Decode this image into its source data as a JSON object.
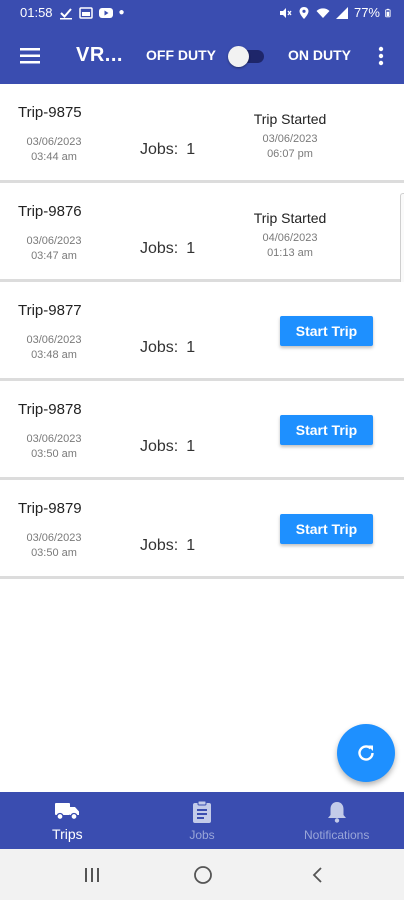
{
  "status_bar": {
    "time": "01:58",
    "battery": "77%",
    "left_icons": [
      "check-icon",
      "photo-icon",
      "youtube-icon",
      "dot-icon"
    ],
    "right_icons": [
      "mute-icon",
      "location-icon",
      "wifi-icon",
      "signal-icon",
      "battery-icon"
    ]
  },
  "app_bar": {
    "title": "VR...",
    "off_duty_label": "OFF DUTY",
    "on_duty_label": "ON DUTY",
    "duty_toggle_on": false
  },
  "jobs_label": "Jobs:",
  "start_trip_label": "Start Trip",
  "trips": [
    {
      "id": "Trip-9875",
      "date": "03/06/2023",
      "time": "03:44 am",
      "jobs": "1",
      "status": "Trip Started",
      "status_date": "03/06/2023",
      "status_time": "06:07 pm"
    },
    {
      "id": "Trip-9876",
      "date": "03/06/2023",
      "time": "03:47 am",
      "jobs": "1",
      "status": "Trip Started",
      "status_date": "04/06/2023",
      "status_time": "01:13 am"
    },
    {
      "id": "Trip-9877",
      "date": "03/06/2023",
      "time": "03:48 am",
      "jobs": "1"
    },
    {
      "id": "Trip-9878",
      "date": "03/06/2023",
      "time": "03:50 am",
      "jobs": "1"
    },
    {
      "id": "Trip-9879",
      "date": "03/06/2023",
      "time": "03:50 am",
      "jobs": "1"
    }
  ],
  "bottom_nav": [
    {
      "label": "Trips",
      "icon": "truck-icon",
      "active": true
    },
    {
      "label": "Jobs",
      "icon": "clipboard-icon",
      "active": false
    },
    {
      "label": "Notifications",
      "icon": "bell-icon",
      "active": false
    }
  ],
  "colors": {
    "primary": "#3a4db0",
    "accent": "#1e90ff",
    "inactive_nav": "#9aa6d8"
  }
}
